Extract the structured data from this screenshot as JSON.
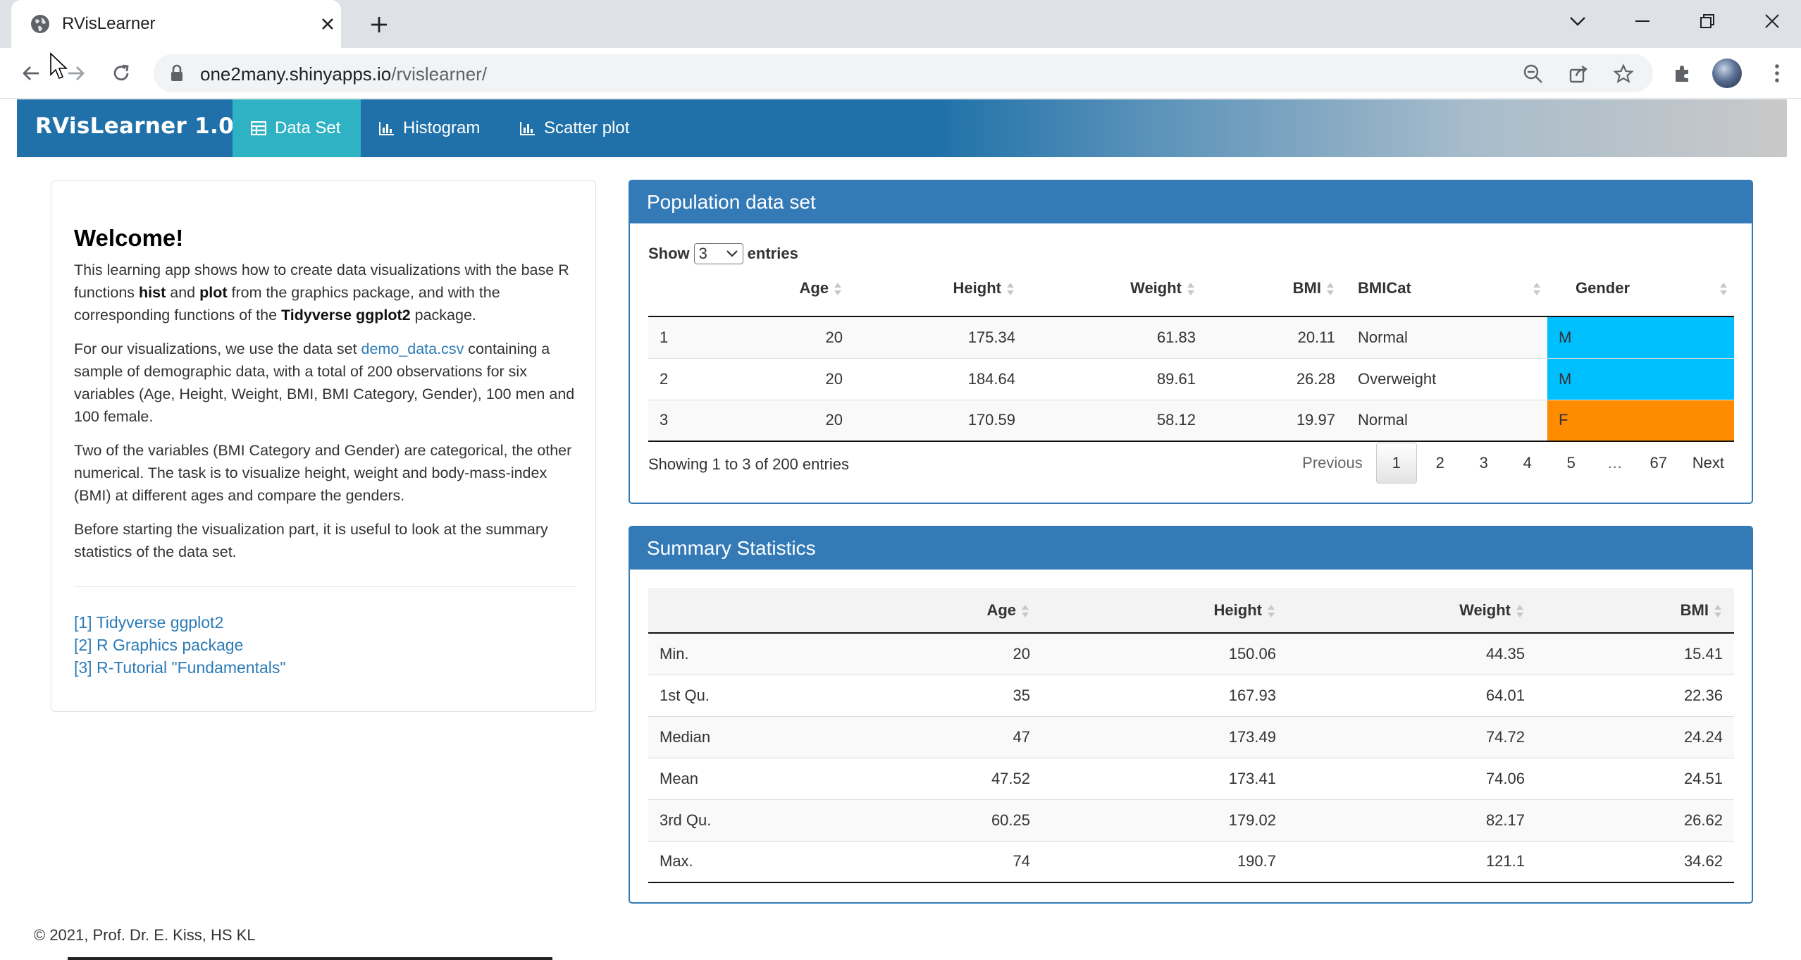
{
  "browser": {
    "tab_title": "RVisLearner",
    "url_host": "one2many.shinyapps.io",
    "url_path": "/rvislearner/"
  },
  "nav": {
    "brand": "RVisLearner 1.0",
    "tabs": [
      {
        "label": "Data Set",
        "icon": "table-icon",
        "active": true
      },
      {
        "label": "Histogram",
        "icon": "bar-chart-icon",
        "active": false
      },
      {
        "label": "Scatter plot",
        "icon": "bar-chart-icon",
        "active": false
      }
    ]
  },
  "welcome": {
    "title": "Welcome!",
    "p1_pre": "This learning app shows how to create data visualizations with the base R functions ",
    "p1_b1": "hist",
    "p1_mid1": " and ",
    "p1_b2": "plot",
    "p1_mid2": " from the graphics package, and with the corresponding functions of the ",
    "p1_b3": "Tidyverse ggplot2",
    "p1_post": " package.",
    "p2_pre": "For our visualizations, we use the data set ",
    "p2_link": "demo_data.csv",
    "p2_post": " containing a sample of demographic data, with a total of 200 observations for six variables (Age, Height, Weight, BMI, BMI Category, Gender), 100 men and 100 female.",
    "p3": "Two of the variables (BMI Category and Gender) are categorical, the other numerical. The task is to visualize height, weight and body-mass-index (BMI) at different ages and compare the genders.",
    "p4": "Before starting the visualization part, it is useful to look at the summary statistics of the data set.",
    "refs": [
      "[1] Tidyverse ggplot2",
      "[2] R Graphics package",
      "[3] R-Tutorial \"Fundamentals\""
    ]
  },
  "population": {
    "title": "Population data set",
    "show_label": "Show",
    "entries_value": "3",
    "entries_label": "entries",
    "columns": [
      "",
      "Age",
      "Height",
      "Weight",
      "BMI",
      "BMICat",
      "Gender"
    ],
    "rows": [
      [
        "1",
        "20",
        "175.34",
        "61.83",
        "20.11",
        "Normal",
        "M"
      ],
      [
        "2",
        "20",
        "184.64",
        "89.61",
        "26.28",
        "Overweight",
        "M"
      ],
      [
        "3",
        "20",
        "170.59",
        "58.12",
        "19.97",
        "Normal",
        "F"
      ]
    ],
    "gender_colors": {
      "M": "#00bfff",
      "F": "#ff8c00"
    },
    "info": "Showing 1 to 3 of 200 entries",
    "pager": {
      "previous": "Previous",
      "pages": [
        "1",
        "2",
        "3",
        "4",
        "5",
        "…",
        "67"
      ],
      "current": "1",
      "next": "Next"
    }
  },
  "summary": {
    "title": "Summary Statistics",
    "columns": [
      "",
      "Age",
      "Height",
      "Weight",
      "BMI"
    ],
    "rows": [
      [
        "Min.",
        "20",
        "150.06",
        "44.35",
        "15.41"
      ],
      [
        "1st Qu.",
        "35",
        "167.93",
        "64.01",
        "22.36"
      ],
      [
        "Median",
        "47",
        "173.49",
        "74.72",
        "24.24"
      ],
      [
        "Mean",
        "47.52",
        "173.41",
        "74.06",
        "24.51"
      ],
      [
        "3rd Qu.",
        "60.25",
        "179.02",
        "82.17",
        "26.62"
      ],
      [
        "Max.",
        "74",
        "190.7",
        "121.1",
        "34.62"
      ]
    ]
  },
  "footer": "© 2021, Prof. Dr. E. Kiss, HS KL",
  "colors": {
    "navbar": "#2071a9",
    "active_tab": "#2fb2c3",
    "panel_header": "#337ab7",
    "link": "#2c7bb6"
  }
}
